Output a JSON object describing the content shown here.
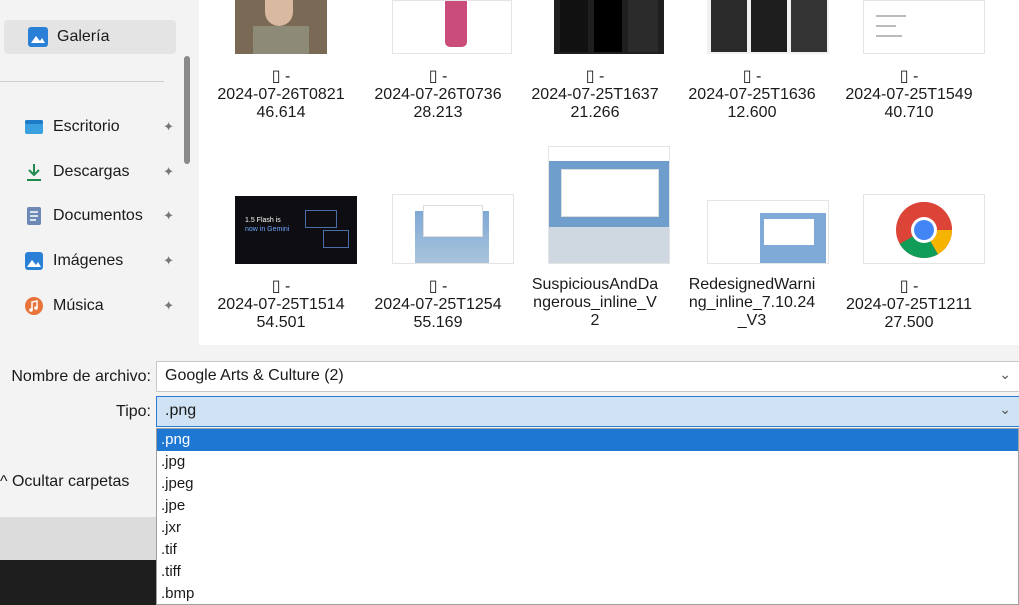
{
  "sidebar": {
    "items": [
      {
        "label": "Galería",
        "icon": "gallery-icon",
        "pinned": false,
        "active": true
      },
      {
        "label": "Escritorio",
        "icon": "desktop-icon",
        "pinned": true
      },
      {
        "label": "Descargas",
        "icon": "download-icon",
        "pinned": true
      },
      {
        "label": "Documentos",
        "icon": "documents-icon",
        "pinned": true
      },
      {
        "label": "Imágenes",
        "icon": "pictures-icon",
        "pinned": true
      },
      {
        "label": "Música",
        "icon": "music-icon",
        "pinned": true
      }
    ],
    "pin_glyph": "📌"
  },
  "files": [
    {
      "line1": "▯ -",
      "line2": "2024-07-26T0821",
      "line3": "46.614"
    },
    {
      "line1": "▯ -",
      "line2": "2024-07-26T0736",
      "line3": "28.213"
    },
    {
      "line1": "▯ -",
      "line2": "2024-07-25T1637",
      "line3": "21.266"
    },
    {
      "line1": "▯ -",
      "line2": "2024-07-25T1636",
      "line3": "12.600"
    },
    {
      "line1": "▯ -",
      "line2": "2024-07-25T1549",
      "line3": "40.710"
    },
    {
      "line1": "▯ -",
      "line2": "2024-07-25T1514",
      "line3": "54.501"
    },
    {
      "line1": "▯ -",
      "line2": "2024-07-25T1254",
      "line3": "55.169"
    },
    {
      "line1": "SuspiciousAndDa",
      "line2": "ngerous_inline_V",
      "line3": "2"
    },
    {
      "line1": "RedesignedWarni",
      "line2": "ng_inline_7.10.24",
      "line3": "_V3"
    },
    {
      "line1": "▯ -",
      "line2": "2024-07-25T1211",
      "line3": "27.500"
    }
  ],
  "thumb_text": {
    "flash": "1.5 Flash is",
    "flash2": "now in Gemini"
  },
  "form": {
    "filename_label": "Nombre de archivo:",
    "filename_value": "Google Arts & Culture  (2)",
    "type_label": "Tipo:",
    "type_value": ".png",
    "chevron": "⌄"
  },
  "hide_folders": "^ Ocultar carpetas",
  "type_options": [
    ".png",
    ".jpg",
    ".jpeg",
    ".jpe",
    ".jxr",
    ".tif",
    ".tiff",
    ".bmp"
  ],
  "colors": {
    "accent": "#1e77d3",
    "selection": "#cfe3f5"
  }
}
